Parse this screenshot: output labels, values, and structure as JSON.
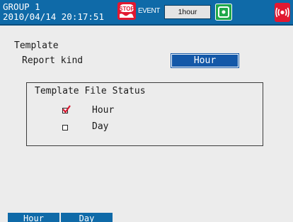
{
  "status_bar": {
    "group_name": "GROUP 1",
    "datetime": "2010/04/14 20:17:51",
    "stop_icon": "stop-badge-icon",
    "event_label": "EVENT",
    "interval_value": "1hour",
    "memory_icon": "memory-card-icon",
    "alarm_icon": "alarm-sound-icon"
  },
  "template": {
    "heading": "Template",
    "report_kind_label": "Report kind",
    "report_kind_value": "Hour"
  },
  "file_status": {
    "title": "Template File Status",
    "items": [
      {
        "label": "Hour",
        "checked": true
      },
      {
        "label": "Day",
        "checked": false
      }
    ]
  },
  "soft_keys": [
    "Hour",
    "Day"
  ],
  "colors": {
    "bar_blue": "#0f6aa8",
    "selected_blue": "#1458a8",
    "alarm_red": "#e21830",
    "check_red": "#d81830",
    "background": "#ececec"
  }
}
